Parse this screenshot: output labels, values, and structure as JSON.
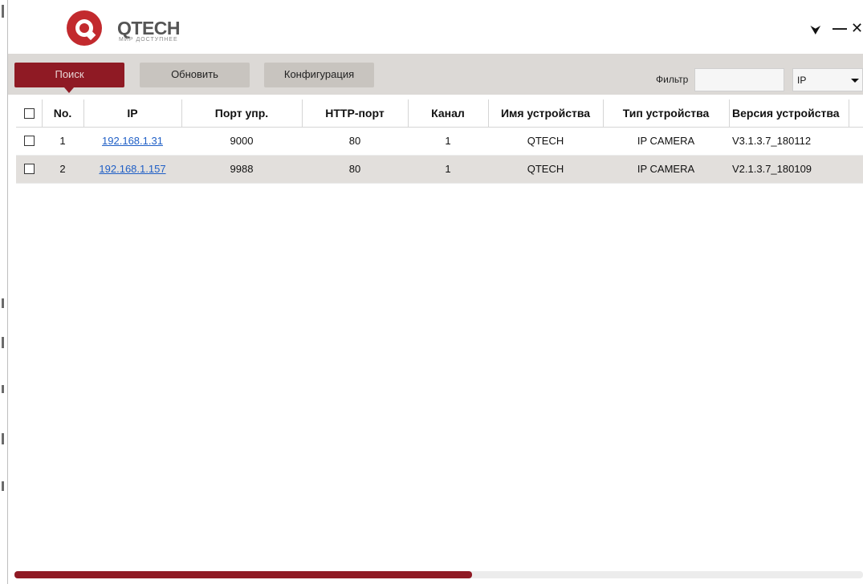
{
  "brand": {
    "name": "QTECH",
    "tagline": "МИР ДОСТУПНЕЕ",
    "color": "#8f1a24"
  },
  "window_controls": {
    "pin": "⮟",
    "minimize": "—",
    "close": "✕"
  },
  "toolbar": {
    "search_label": "Поиск",
    "refresh_label": "Обновить",
    "config_label": "Конфигурация",
    "filter_label": "Фильтр",
    "filter_value": "",
    "filter_type": "IP"
  },
  "table": {
    "columns": [
      "No.",
      "IP",
      "Порт упр.",
      "HTTP-порт",
      "Канал",
      "Имя устройства",
      "Тип устройства",
      "Версия устройства"
    ],
    "rows": [
      {
        "no": "1",
        "ip": "192.168.1.31",
        "port": "9000",
        "http_port": "80",
        "channel": "1",
        "name": "QTECH",
        "type": "IP CAMERA",
        "version": "V3.1.3.7_180112"
      },
      {
        "no": "2",
        "ip": "192.168.1.157",
        "port": "9988",
        "http_port": "80",
        "channel": "1",
        "name": "QTECH",
        "type": "IP CAMERA",
        "version": "V2.1.3.7_180109"
      }
    ]
  },
  "scrollbar": {
    "position_fraction": 0.54
  }
}
